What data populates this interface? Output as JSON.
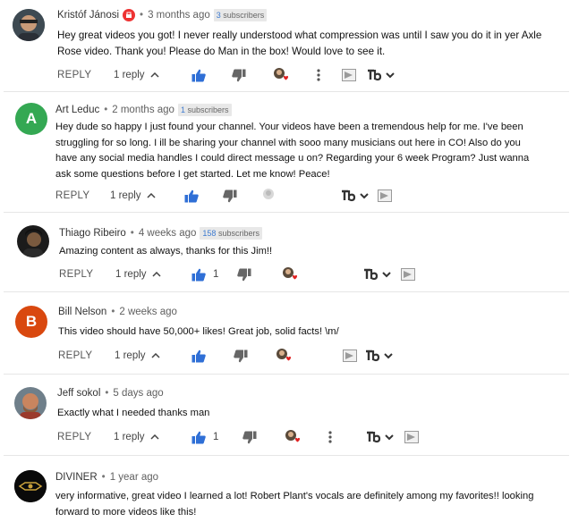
{
  "comments": [
    {
      "author": "Kristóf Jánosi",
      "time": "3 months ago",
      "subs_count": "3",
      "subs_word": "subscribers",
      "text": "Hey great videos you got! I never really understood what compression was until I saw you do it in yer Axle Rose video. Thank you! Please do Man in the box! Would love to see it.",
      "reply_label": "REPLY",
      "replies_label": "1 reply"
    },
    {
      "author": "Art Leduc",
      "avatar_letter": "A",
      "time": "2 months ago",
      "subs_count": "1",
      "subs_word": "subscribers",
      "text": "Hey dude so happy I just found your channel.  Your videos have been a tremendous help for me.  I've been struggling for so long.  I ill be sharing your channel with sooo many musicians out here in CO!  Also do you have any social media handles I could direct message u on?  Regarding your 6 week Program?  Just wanna ask some questions before I get started.  Let me know! Peace!",
      "reply_label": "REPLY",
      "replies_label": "1 reply"
    },
    {
      "author": "Thiago Ribeiro",
      "time": "4 weeks ago",
      "subs_count": "158",
      "subs_word": "subscribers",
      "text": "Amazing content as always, thanks for this Jim!!",
      "reply_label": "REPLY",
      "replies_label": "1 reply",
      "likes": "1"
    },
    {
      "author": "Bill Nelson",
      "avatar_letter": "B",
      "time": "2 weeks ago",
      "text": "This video should have 50,000+ likes! Great job, solid facts!  \\m/",
      "reply_label": "REPLY",
      "replies_label": "1 reply"
    },
    {
      "author": "Jeff sokol",
      "time": "5 days ago",
      "text": "Exactly what I needed thanks man",
      "reply_label": "REPLY",
      "replies_label": "1 reply",
      "likes": "1"
    },
    {
      "author": "DIVINER",
      "time": "1 year ago",
      "text": "very informative, great video I learned a lot! Robert Plant's vocals are definitely among my favorites!! looking forward to more videos like this!"
    }
  ],
  "colors": {
    "like_blue": "#2f6fd6",
    "dislike_gray": "#666666",
    "avatar_green": "#34a853",
    "avatar_orange": "#d9480f",
    "heart_red": "#e02020"
  },
  "icons": [
    "thumbs-up-icon",
    "thumbs-down-icon",
    "creator-heart-icon",
    "more-vert-icon",
    "translate-icon",
    "tubebuddy-icon",
    "chevron-down-icon",
    "chevron-up-icon"
  ]
}
